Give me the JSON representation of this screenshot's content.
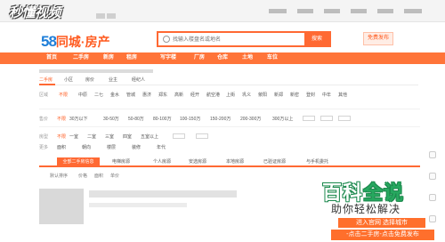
{
  "watermark": "秒懂视频",
  "logo": {
    "num": "58",
    "name": "同城·房产"
  },
  "search": {
    "placeholder": "找输入楼盘名或地名",
    "button": "搜索"
  },
  "publish_button": "免费发布",
  "nav": {
    "items": [
      "首页",
      "二手房",
      "新房",
      "租房",
      "写字楼",
      "厂房",
      "仓库",
      "土地",
      "车位"
    ]
  },
  "subtabs": {
    "items": [
      "二手房",
      "小区",
      "房价",
      "业主",
      "经纪人"
    ],
    "active": 0
  },
  "filters": {
    "region": {
      "label": "区域",
      "items": [
        "不限",
        "中原",
        "二七",
        "金水",
        "管城",
        "惠济",
        "郑东",
        "高新",
        "经开",
        "航空港",
        "上街",
        "巩义",
        "荥阳",
        "新郑",
        "新密",
        "登封",
        "中牟",
        "其他"
      ]
    },
    "price": {
      "label": "售价",
      "items": [
        "不限",
        "30万以下",
        "30-50万",
        "50-80万",
        "80-100万",
        "100-150万",
        "150-200万",
        "200-300万",
        "300万以上"
      ]
    },
    "rooms": {
      "label": "房型",
      "items": [
        "不限",
        "一室",
        "二室",
        "三室",
        "四室",
        "五室以上"
      ]
    },
    "more": {
      "label": "更多",
      "items": [
        "面积",
        "朝向",
        "楼层",
        "装修",
        "年代"
      ]
    }
  },
  "list_tabs": {
    "items": [
      "全部二手房信息",
      "电梯房源",
      "个人房源",
      "安选房源",
      "本地房源",
      "已验证房源",
      "与手机委托"
    ],
    "active": 0
  },
  "sort": {
    "items": [
      "默认排序",
      "价格",
      "面积",
      "单价"
    ]
  },
  "overlay": {
    "title_a": "百科",
    "title_b": "全说",
    "subtitle": "助你轻松解决",
    "line1": "进入官网 选择城市",
    "line2": "-点击二手房-点击免费发布"
  }
}
